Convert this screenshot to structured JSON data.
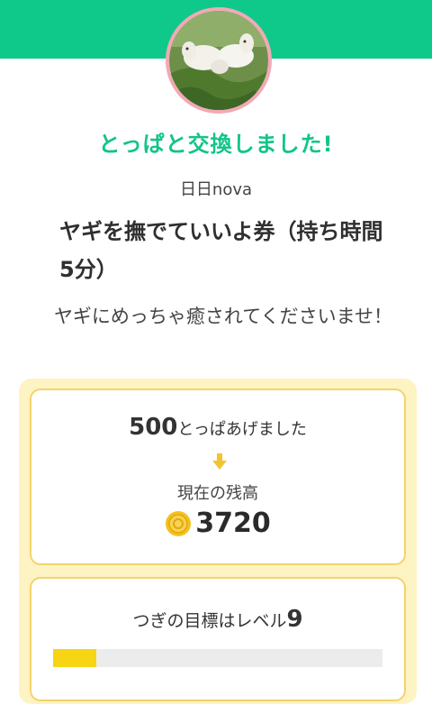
{
  "header": {
    "band_color": "#0fc98a"
  },
  "avatar": {
    "alt": "goats photo",
    "border_color": "#f2a9b6"
  },
  "exchange": {
    "title": "とっぱと交換しました!",
    "title_color": "#12c48a",
    "shop_name": "日日nova",
    "item_name": "ヤギを撫でていいよ券（持ち時間5分）",
    "message": "ヤギにめっちゃ癒されてくださいませ！"
  },
  "balance": {
    "given_amount": "500",
    "given_suffix": "とっぱあげました",
    "arrow_icon": "arrow-down-icon",
    "current_label": "現在の残高",
    "coin_icon": "coin-icon",
    "current_value": "3720"
  },
  "goal": {
    "label": "つぎの目標はレベル",
    "level": "9",
    "progress_fraction": 0.13,
    "fill_color": "#f7d414"
  },
  "panel": {
    "background": "#fdf3c3",
    "card_border": "#f4d36a"
  }
}
